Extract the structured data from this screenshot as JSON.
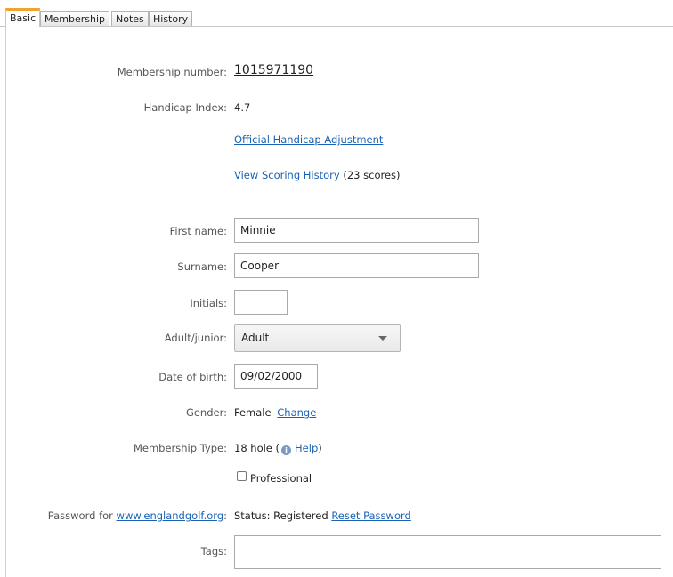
{
  "tabs": [
    {
      "label": "Basic"
    },
    {
      "label": "Membership"
    },
    {
      "label": "Notes"
    },
    {
      "label": "History"
    }
  ],
  "membership_number": {
    "label": "Membership number:",
    "value": "1015971190"
  },
  "handicap_index": {
    "label": "Handicap Index:",
    "value": "4.7"
  },
  "official_handicap_adjustment": {
    "link": "Official Handicap Adjustment"
  },
  "scoring_history": {
    "link": "View Scoring History",
    "count_text": "23 scores",
    "open_paren": "(",
    "close_paren": ")"
  },
  "first_name": {
    "label": "First name:",
    "value": "Minnie"
  },
  "surname": {
    "label": "Surname:",
    "value": "Cooper"
  },
  "initials": {
    "label": "Initials:",
    "value": ""
  },
  "adult_junior": {
    "label": "Adult/junior:",
    "selected": "Adult"
  },
  "date_of_birth": {
    "label": "Date of birth:",
    "value": "09/02/2000"
  },
  "gender": {
    "label": "Gender:",
    "value": "Female",
    "change_link": "Change"
  },
  "membership_type": {
    "label": "Membership Type:",
    "value": "18 hole (",
    "info_icon": "info-icon",
    "help_link": "Help",
    "close_paren": ")"
  },
  "professional": {
    "label": "Professional",
    "checked": false
  },
  "password": {
    "label_prefix": "Password for ",
    "site_link": "www.englandgolf.org",
    "label_suffix": ":",
    "status": "Status: Registered",
    "reset_link": "Reset Password"
  },
  "tags": {
    "label": "Tags:",
    "value": ""
  },
  "colors": {
    "accent_tab": "#f0a32e",
    "link": "#1a62b5"
  }
}
